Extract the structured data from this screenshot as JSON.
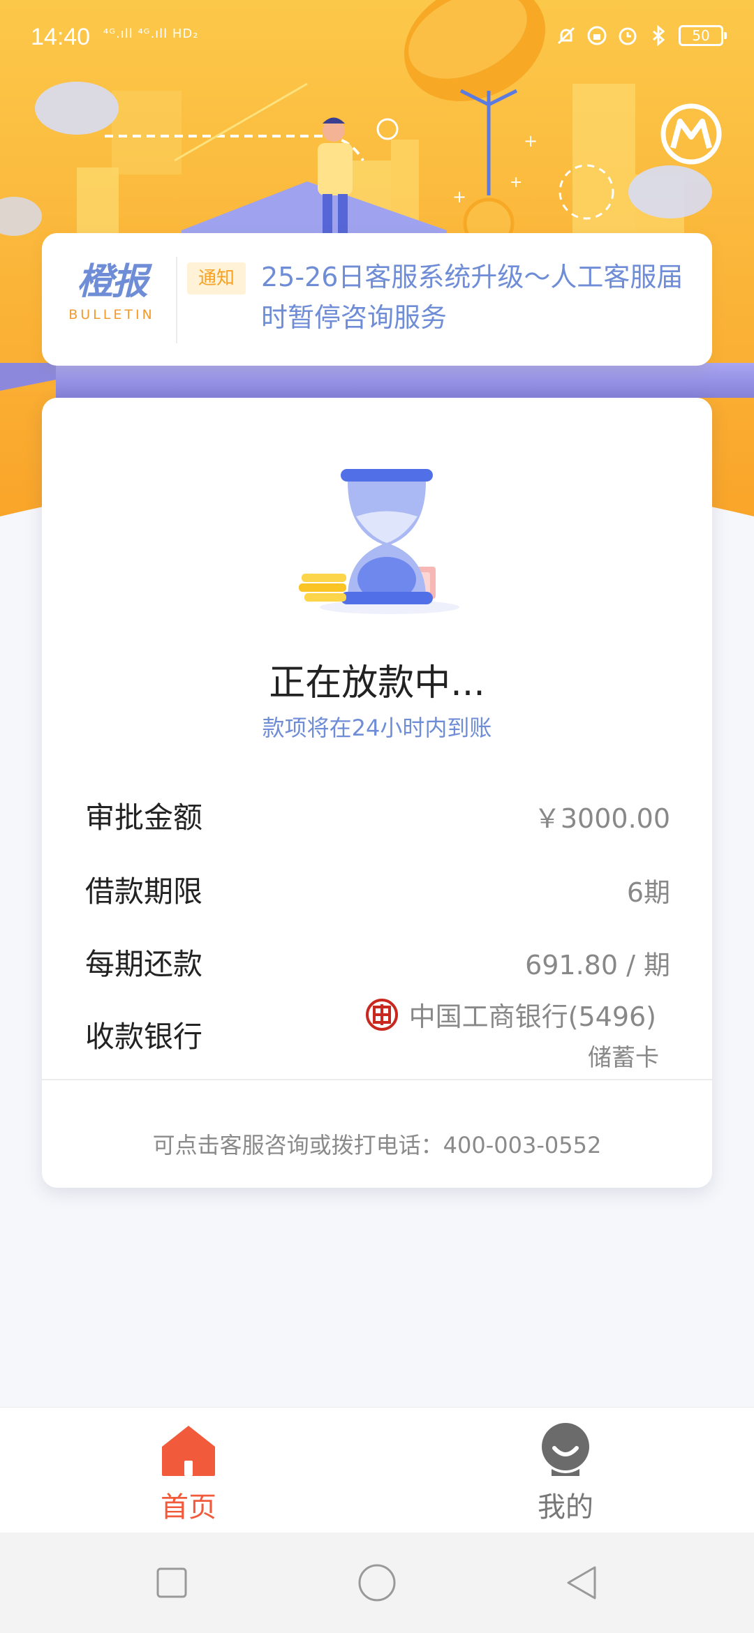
{
  "status_bar": {
    "time": "14:40",
    "signal_text": "⁴ᴳ.ıll ⁴ᴳ.ıll HD₂",
    "battery": "50"
  },
  "bulletin": {
    "logo_cn": "橙报",
    "logo_en": "BULLETIN",
    "tag": "通知",
    "text": "25-26日客服系统升级～人工客服届时暂停咨询服务"
  },
  "card": {
    "status_title": "正在放款中...",
    "status_subtitle": "款项将在24小时内到账",
    "rows": [
      {
        "label": "审批金额",
        "value": "￥3000.00"
      },
      {
        "label": "借款期限",
        "value": "6期"
      },
      {
        "label": "每期还款",
        "value": "691.80 / 期"
      },
      {
        "label": "收款银行",
        "value": "中国工商银行(5496)"
      }
    ],
    "bank_card_type": "储蓄卡",
    "footer": "可点击客服咨询或拨打电话：400-003-0552"
  },
  "tabs": [
    {
      "label": "首页",
      "icon": "home-icon",
      "active": true
    },
    {
      "label": "我的",
      "icon": "profile-icon",
      "active": false
    }
  ],
  "colors": {
    "hero_orange": "#fbb635",
    "accent_blue": "#6f8dd6",
    "tab_active": "#f25a3c",
    "notice_tag": "#f5a124"
  }
}
